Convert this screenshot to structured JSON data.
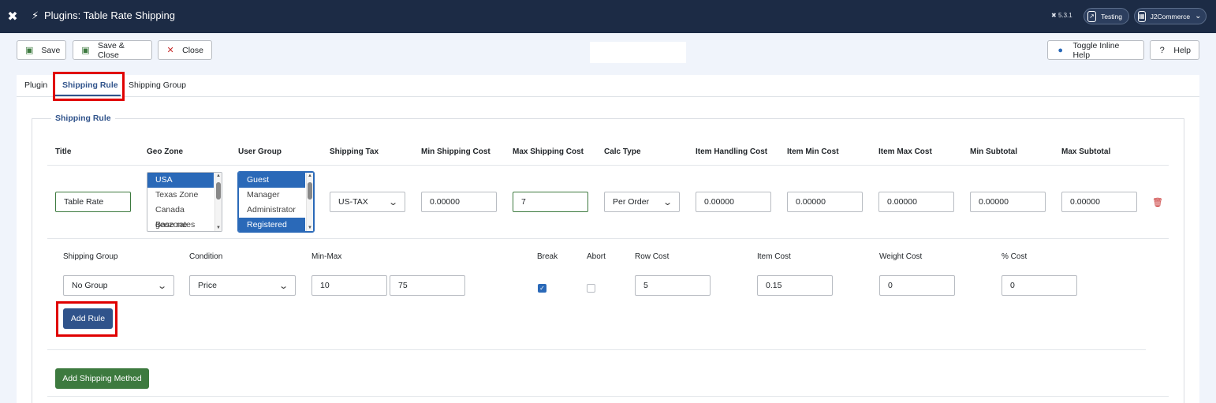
{
  "header": {
    "title": "Plugins: Table Rate Shipping",
    "version": "5.3.1",
    "site_link": "Testing",
    "user_menu": "J2Commerce"
  },
  "toolbar": {
    "save": "Save",
    "save_close": "Save & Close",
    "close": "Close",
    "toggle_help": "Toggle Inline Help",
    "help": "Help"
  },
  "tabs": [
    "Plugin",
    "Shipping Rule",
    "Shipping Group"
  ],
  "rule": {
    "legend": "Shipping Rule",
    "headers": [
      "Title",
      "Geo Zone",
      "User Group",
      "Shipping Tax",
      "Min Shipping Cost",
      "Max Shipping Cost",
      "Calc Type",
      "Item Handling Cost",
      "Item Min Cost",
      "Item Max Cost",
      "Min Subtotal",
      "Max Subtotal"
    ],
    "title_value": "Table Rate",
    "geo_zones": [
      "USA",
      "Texas Zone",
      "Canada geozone",
      "Base rates"
    ],
    "user_groups": [
      "Guest",
      "Manager",
      "Administrator",
      "Registered"
    ],
    "shipping_tax": "US-TAX",
    "min_shipping_cost": "0.00000",
    "max_shipping_cost": "7",
    "calc_type": "Per Order",
    "item_handling_cost": "0.00000",
    "item_min_cost": "0.00000",
    "item_max_cost": "0.00000",
    "min_subtotal": "0.00000",
    "max_subtotal": "0.00000"
  },
  "subrule": {
    "headers": [
      "Shipping Group",
      "Condition",
      "Min-Max",
      "Break",
      "Abort",
      "Row Cost",
      "Item Cost",
      "Weight Cost",
      "% Cost"
    ],
    "shipping_group": "No Group",
    "condition": "Price",
    "min": "10",
    "max": "75",
    "break_checked": true,
    "abort_checked": false,
    "row_cost": "5",
    "item_cost": "0.15",
    "weight_cost": "0",
    "percent_cost": "0"
  },
  "buttons": {
    "add_rule": "Add Rule",
    "add_shipping_method": "Add Shipping Method"
  }
}
